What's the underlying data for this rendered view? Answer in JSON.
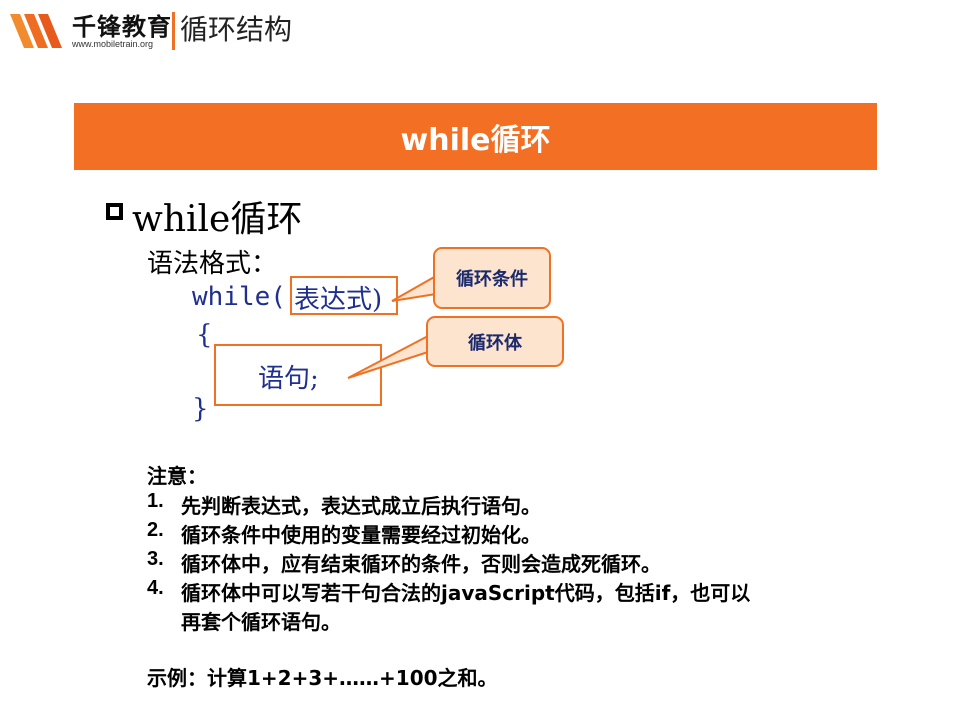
{
  "header": {
    "brand_name": "千锋教育",
    "brand_url": "www.mobiletrain.org",
    "title": "循环结构"
  },
  "banner": {
    "title": "while循环"
  },
  "bullet": {
    "text": "while循环"
  },
  "syntax": {
    "label": "语法格式：",
    "line1_keyword": "while(",
    "line1_expr": "表达式)",
    "open_brace": "{",
    "statement": "语句;",
    "close_brace": "}"
  },
  "callouts": {
    "condition": "循环条件",
    "body": "循环体"
  },
  "notes": {
    "heading": "注意：",
    "items": [
      {
        "num": "1.",
        "text": "先判断表达式，表达式成立后执行语句。"
      },
      {
        "num": "2.",
        "text": "循环条件中使用的变量需要经过初始化。"
      },
      {
        "num": "3.",
        "text": "循环体中，应有结束循环的条件，否则会造成死循环。"
      },
      {
        "num": "4.",
        "text": "循环体中可以写若干句合法的javaScript代码，包括if，也可以"
      }
    ],
    "item4_cont": "再套个循环语句。",
    "example": "示例：计算1+2+3+……+100之和。"
  },
  "colors": {
    "accent": "#f26f23",
    "code": "#1f2f8f",
    "callout_fill": "#fde4cf"
  }
}
